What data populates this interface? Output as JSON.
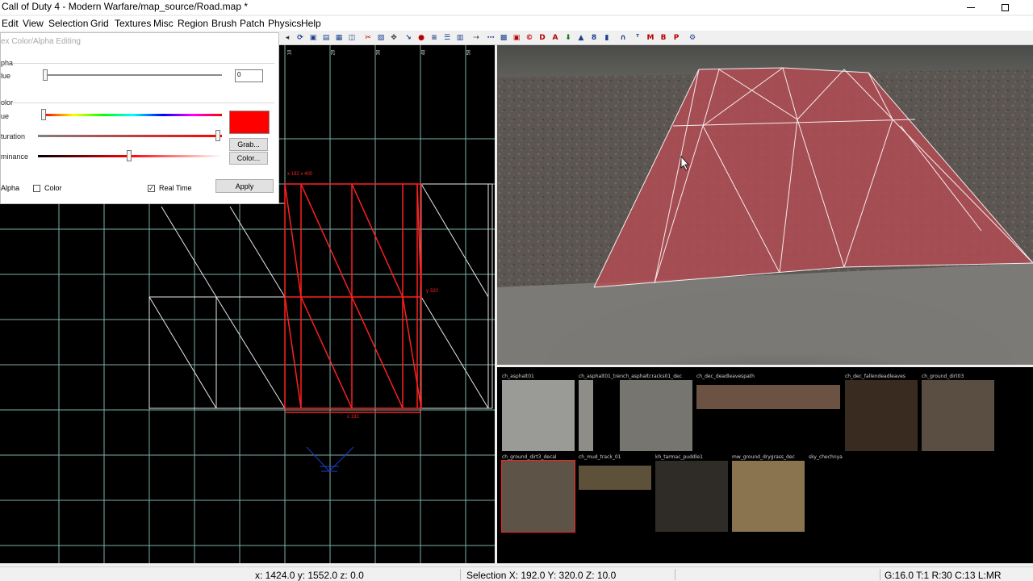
{
  "window": {
    "title": "Call of Duty 4 - Modern Warfare/map_source/Road.map *"
  },
  "menu": {
    "items": [
      "Edit",
      "View",
      "Selection",
      "Grid",
      "Textures",
      "Misc",
      "Region",
      "Brush",
      "Patch",
      "Physics",
      "Help"
    ]
  },
  "dialog": {
    "title": "ex Color/Alpha Editing",
    "alpha_group": "pha",
    "value_label": "lue",
    "value_input": "0",
    "color_group": "olor",
    "hue_label": "ue",
    "saturation_label": "turation",
    "luminance_label": "minance",
    "swatch_color": "#ff0000",
    "grab_label": "Grab...",
    "color_button_label": "Color...",
    "alpha_check_label": "Alpha",
    "color_check_label": "Color",
    "color_checked": false,
    "realtime_label": "Real Time",
    "realtime_checked": true,
    "apply_label": "Apply"
  },
  "textures": [
    {
      "name": "ch_asphalt01",
      "color": "#9a9a96"
    },
    {
      "name": "ch_asphalt01_trench_asphaltcracks01_dec",
      "color": "#777570"
    },
    {
      "name": "ch_dec_deadleavespath",
      "color": "#6b5242"
    },
    {
      "name": "ch_dec_fallendeadleaves",
      "color": "#3a2b20"
    },
    {
      "name": "ch_ground_dirt03",
      "color": "#5a4e42"
    },
    {
      "name": "ch_ground_dirt3_decal",
      "color": "#5e5347"
    },
    {
      "name": "ch_mud_track_01",
      "color": "#5d5139"
    },
    {
      "name": "kh_tarmac_puddle1",
      "color": "#2f2c28"
    },
    {
      "name": "mw_ground_drygrass_dec",
      "color": "#8a7450"
    },
    {
      "name": "sky_chechnya",
      "color": "#000000"
    }
  ],
  "status": {
    "coords": "x: 1424.0  y: 1552.0  z: 0.0",
    "selection": "Selection X: 192.0  Y: 320.0  Z: 10.0",
    "grid": "G:16.0 T:1 R:30 C:13 L:MR"
  },
  "viewport2d": {
    "tick_labels": [
      "18",
      "28",
      "38",
      "48",
      "58"
    ],
    "selection_size_label": "x 192 x 400",
    "selection_side_label": "y 320",
    "selection_bottom_label": "x 192"
  },
  "colors": {
    "grid": "#7ab0a8",
    "selection": "#ff2020",
    "brush_white": "#e8e8e8",
    "selection_fill": "#b84a52"
  }
}
